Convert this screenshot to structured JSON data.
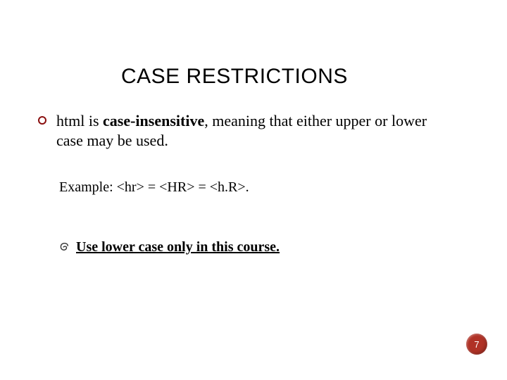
{
  "title": "CASE RESTRICTIONS",
  "bullet1": {
    "pre": "html is ",
    "bold": "case-insensitive",
    "post": ", meaning that either upper or lower case may be used."
  },
  "example": "Example: <hr> = <HR> = <h.R>.",
  "sub": "Use lower case only in this course.",
  "page": "7"
}
